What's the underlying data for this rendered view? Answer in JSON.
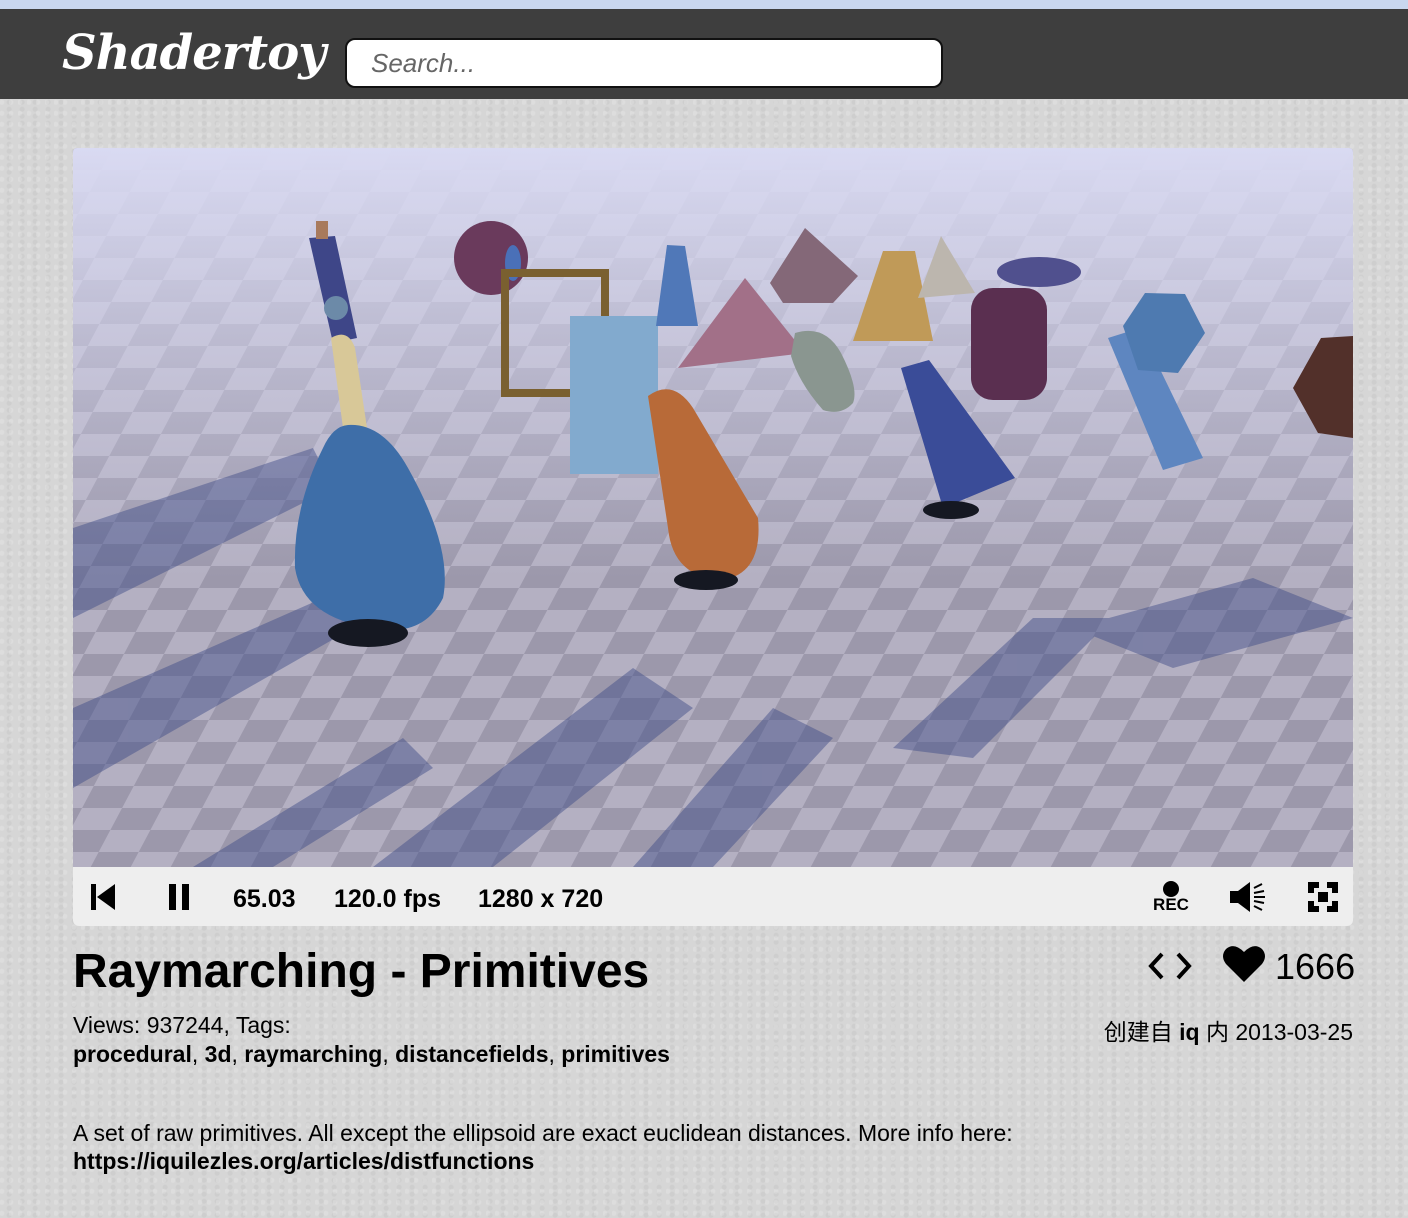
{
  "header": {
    "logo": "Shadertoy",
    "search_placeholder": "Search..."
  },
  "player": {
    "time": "65.03",
    "fps": "120.0 fps",
    "resolution": "1280 x 720",
    "rec_label": "REC",
    "icons": [
      "rewind-icon",
      "pause-icon",
      "record-icon",
      "volume-icon",
      "fullscreen-icon"
    ]
  },
  "shader": {
    "title": "Raymarching - Primitives",
    "views_label": "Views: 937244, Tags:",
    "tags": [
      "procedural",
      "3d",
      "raymarching",
      "distancefields",
      "primitives"
    ],
    "likes": "1666",
    "created_prefix": "创建自",
    "author": "iq",
    "created_mid": "内",
    "date": "2013-03-25",
    "description": "A set of raw primitives. All except the ellipsoid are exact euclidean distances. More info here:",
    "link": "https://iquilezles.org/articles/distfunctions"
  },
  "colors": {
    "header_bg": "#3e3e3e",
    "controls_bg": "#eeeeee",
    "page_bg": "#d6d6d6"
  }
}
